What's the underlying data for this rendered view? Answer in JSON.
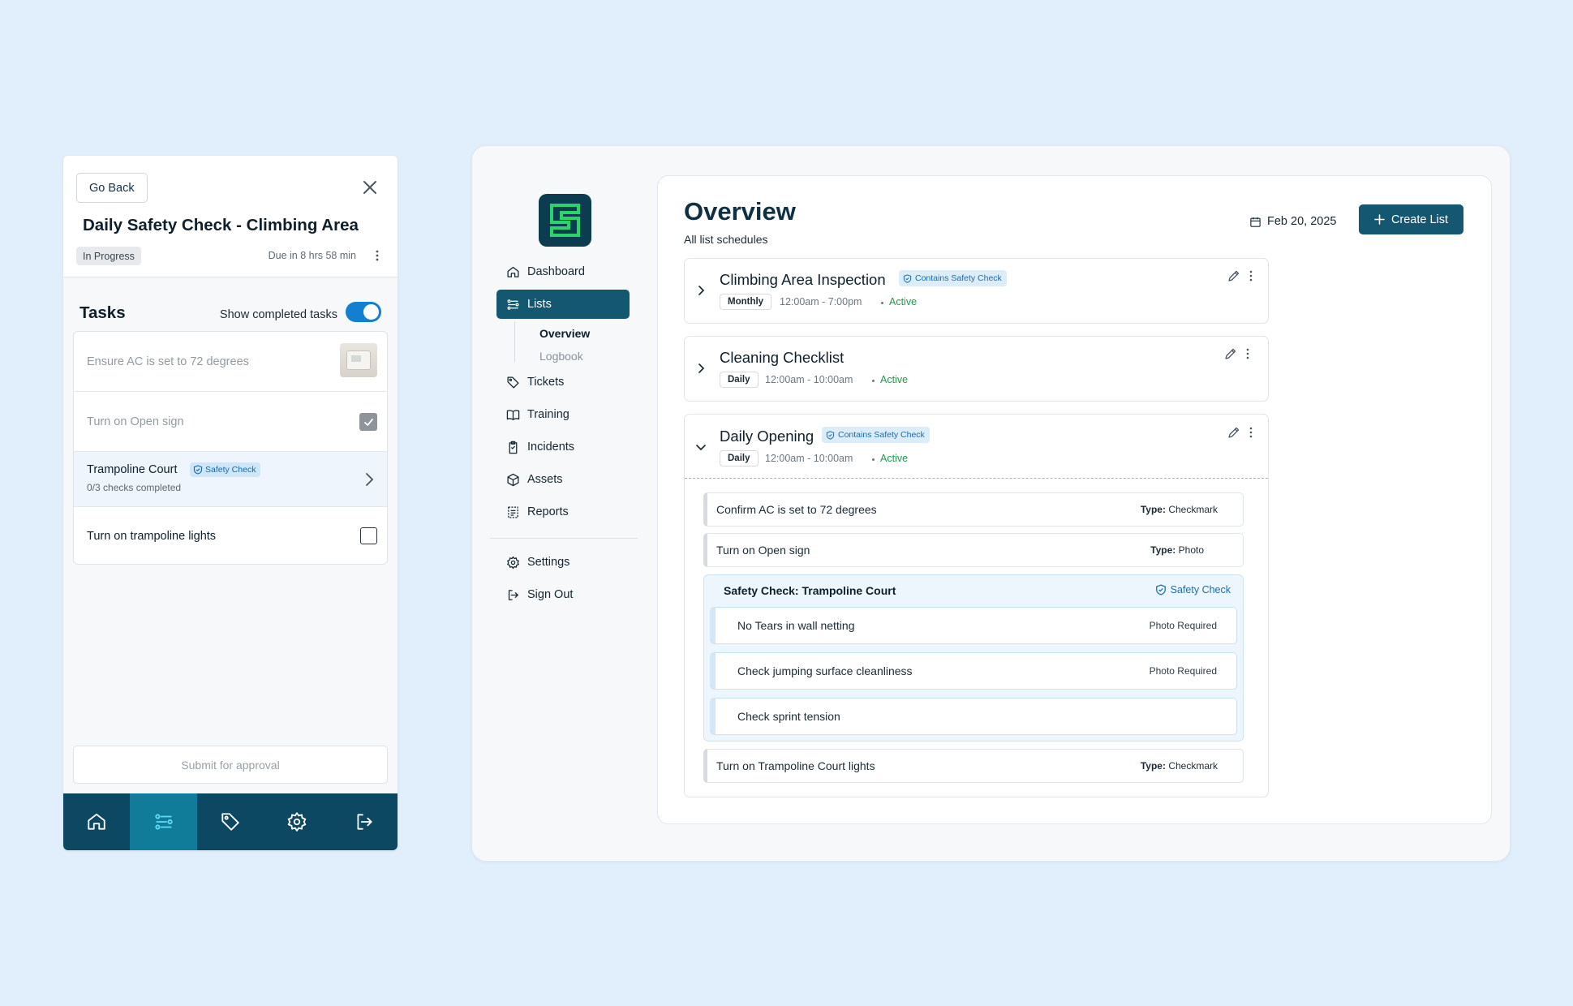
{
  "mobile": {
    "go_back": "Go Back",
    "title": "Daily Safety Check - Climbing Area",
    "status": "In Progress",
    "due": "Due in 8 hrs 58 min",
    "tasks_title": "Tasks",
    "show_completed_label": "Show completed tasks",
    "show_completed": true,
    "tasks": [
      {
        "label": "Ensure AC is set to 72 degrees"
      },
      {
        "label": "Turn on Open sign",
        "checked": true
      },
      {
        "label": "Trampoline Court",
        "badge": "Safety Check",
        "sub": "0/3 checks completed"
      },
      {
        "label": "Turn on trampoline lights",
        "checked": false
      }
    ],
    "submit": "Submit for approval",
    "nav": [
      {
        "icon": "home-icon"
      },
      {
        "icon": "lists-icon",
        "active": true
      },
      {
        "icon": "tag-icon"
      },
      {
        "icon": "gear-icon"
      },
      {
        "icon": "sign-out-icon"
      }
    ]
  },
  "sidebar": {
    "items": [
      {
        "label": "Dashboard",
        "icon": "home-icon"
      },
      {
        "label": "Lists",
        "icon": "lists-icon",
        "active": true
      },
      {
        "label": "Tickets",
        "icon": "tag-icon"
      },
      {
        "label": "Training",
        "icon": "book-icon"
      },
      {
        "label": "Incidents",
        "icon": "clipboard-icon"
      },
      {
        "label": "Assets",
        "icon": "package-icon"
      },
      {
        "label": "Reports",
        "icon": "report-icon"
      }
    ],
    "sub_items": [
      "Overview",
      "Logbook"
    ],
    "bottom": [
      {
        "label": "Settings",
        "icon": "gear-icon"
      },
      {
        "label": "Sign Out",
        "icon": "sign-out-icon"
      }
    ]
  },
  "main": {
    "title": "Overview",
    "subtitle": "All list schedules",
    "date": "Feb 20, 2025",
    "create_button": "Create List",
    "lists": [
      {
        "title": "Climbing Area Inspection",
        "badge": "Contains Safety Check",
        "frequency": "Monthly",
        "time": "12:00am - 7:00pm",
        "status": "Active"
      },
      {
        "title": "Cleaning Checklist",
        "frequency": "Daily",
        "time": "12:00am - 10:00am",
        "status": "Active"
      },
      {
        "title": "Daily Opening",
        "badge": "Contains Safety Check",
        "frequency": "Daily",
        "time": "12:00am - 10:00am",
        "status": "Active",
        "items": [
          {
            "label": "Confirm AC is set to 72 degrees",
            "type_label": "Type:",
            "type": "Checkmark"
          },
          {
            "label": "Turn on Open sign",
            "type_label": "Type:",
            "type": "Photo"
          },
          {
            "label": "Turn on Trampoline Court lights",
            "type_label": "Type:",
            "type": "Checkmark"
          }
        ],
        "safety_group": {
          "title": "Safety Check: Trampoline Court",
          "badge": "Safety Check",
          "items": [
            {
              "label": "No Tears in wall netting",
              "requirement": "Photo Required"
            },
            {
              "label": "Check jumping surface cleanliness",
              "requirement": "Photo Required"
            },
            {
              "label": "Check sprint tension",
              "requirement": ""
            }
          ]
        }
      }
    ]
  },
  "colors": {
    "background": "#e0effb",
    "primary": "#145770",
    "nav_dark": "#0d4862",
    "nav_active": "#117c9a",
    "accent_green": "#1f9a4b",
    "toggle_blue": "#137fd1",
    "badge_blue": "#1d6ca8",
    "logo_green": "#2bd46a"
  }
}
